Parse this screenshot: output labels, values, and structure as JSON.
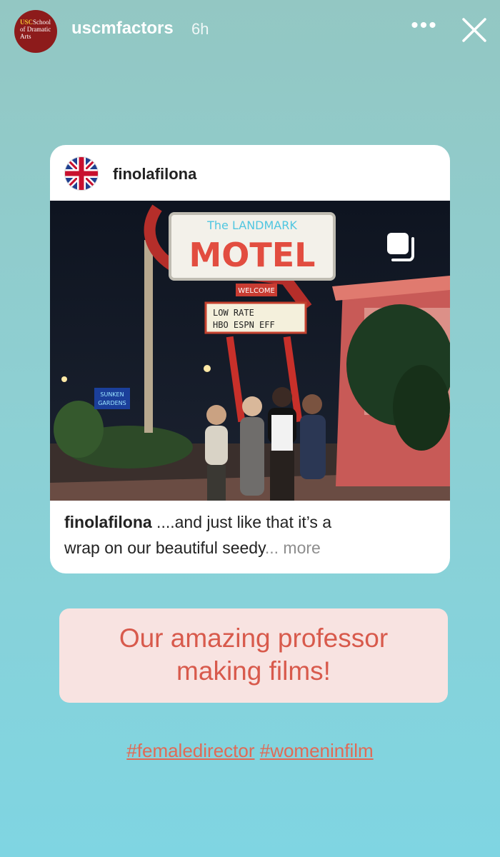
{
  "story": {
    "avatar_text_1": "USC",
    "avatar_text_2": "School",
    "avatar_text_3": "of Dramatic Arts",
    "username": "uscmfactors",
    "time": "6h",
    "more_icon": "more-horizontal-icon",
    "close_icon": "close-icon"
  },
  "post": {
    "username": "finolafilona",
    "avatar_icon": "union-jack-flag-icon",
    "multi_image_icon": "carousel-icon",
    "sign": {
      "top": "The LANDMARK",
      "main": "MOTEL",
      "welcome": "WELCOME",
      "marquee_1": "LOW RATE",
      "marquee_2": "HBO ESPN EFF",
      "gardens_1": "SUNKEN",
      "gardens_2": "GARDENS"
    },
    "caption_user": "finolafilona",
    "caption_text_1": " ....and just like that it’s a",
    "caption_text_2": "wrap on our beautiful seedy",
    "caption_more": "... more"
  },
  "sticker": {
    "line1": "Our amazing professor",
    "line2": "making films!"
  },
  "hashtags": {
    "tag1": "#femaledirector",
    "tag2": "#womeninfilm"
  },
  "colors": {
    "accent_text": "#d85a4c",
    "sticker_bg": "#f8e3e1",
    "hashtag": "#e06a55"
  }
}
